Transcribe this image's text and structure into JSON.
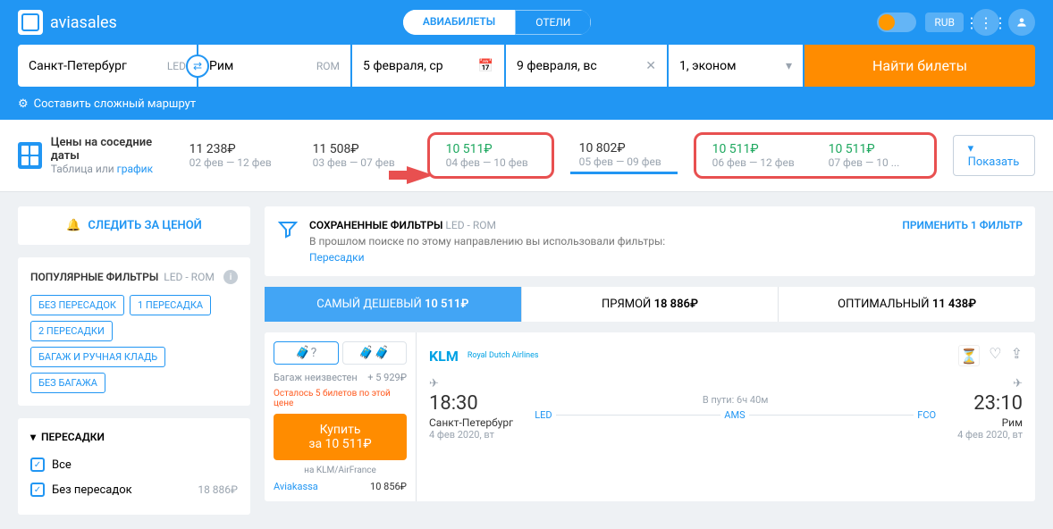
{
  "header": {
    "brand": "aviasales",
    "tabs": {
      "flights": "АВИАБИЛЕТЫ",
      "hotels": "ОТЕЛИ"
    },
    "currency": "RUB"
  },
  "search": {
    "from": {
      "city": "Санкт-Петербург",
      "code": "LED"
    },
    "to": {
      "city": "Рим",
      "code": "ROM"
    },
    "depart": "5 февраля, ср",
    "return": "9 февраля, вс",
    "pax": "1, эконом",
    "button": "Найти билеты"
  },
  "subheader": {
    "complex_route": "Составить сложный маршрут"
  },
  "datebar": {
    "title": "Цены на соседние даты",
    "sub_table": "Таблица",
    "sub_or": " или ",
    "sub_chart": "график",
    "show": "Показать",
    "cells": [
      {
        "price": "11 238₽",
        "dates": "02 фев — 12 фев",
        "green": false,
        "ring": false
      },
      {
        "price": "11 508₽",
        "dates": "03 фев — 07 фев",
        "green": false,
        "ring": false
      },
      {
        "price": "10 511₽",
        "dates": "04 фев — 10 фев",
        "green": true,
        "ring": true
      },
      {
        "price": "10 802₽",
        "dates": "05 фев — 09 фев",
        "green": false,
        "ring": false,
        "active": true
      },
      {
        "price": "10 511₽",
        "dates": "06 фев — 12 фев",
        "green": true,
        "ring": true
      },
      {
        "price": "10 511₽",
        "dates": "07 фев — 10 ...",
        "green": true,
        "ring": true
      }
    ]
  },
  "sidebar": {
    "watch": "СЛЕДИТЬ ЗА ЦЕНОЙ",
    "popular_h": "ПОПУЛЯРНЫЕ ФИЛЬТРЫ",
    "popular_sub": "LED - ROM",
    "chips": [
      "БЕЗ ПЕРЕСАДОК",
      "1 ПЕРЕСАДКА",
      "2 ПЕРЕСАДКИ",
      "БАГАЖ И РУЧНАЯ КЛАДЬ",
      "БЕЗ БАГАЖА"
    ],
    "transfers_h": "ПЕРЕСАДКИ",
    "cb_all": "Все",
    "cb_direct": "Без пересадок",
    "cb_direct_price": "18 886₽"
  },
  "saved": {
    "title": "СОХРАНЕННЫЕ ФИЛЬТРЫ",
    "sub": "LED - ROM",
    "desc": "В прошлом поиске по этому направлению вы использовали фильтры:",
    "link": "Пересадки",
    "apply": "ПРИМЕНИТЬ 1 ФИЛЬТР"
  },
  "sort": {
    "cheapest": {
      "label": "САМЫЙ ДЕШЕВЫЙ",
      "price": "10 511₽"
    },
    "direct": {
      "label": "ПРЯМОЙ",
      "price": "18 886₽"
    },
    "optimal": {
      "label": "ОПТИМАЛЬНЫЙ",
      "price": "11 438₽"
    }
  },
  "ticket": {
    "bag_unknown": "Багаж неизвестен",
    "bag_plus": "+ 5 929₽",
    "remain": "Осталось 5 билетов по этой цене",
    "buy_l1": "Купить",
    "buy_l2": "за 10 511₽",
    "via": "на KLM/AirFrance",
    "alt_name": "Aviakassa",
    "alt_price": "10 856₽",
    "airline": "KLM",
    "airline_sub": "Royal Dutch Airlines",
    "dep_time": "18:30",
    "dep_city": "Санкт-Петербург",
    "dep_date": "4 фев 2020, вт",
    "dep_code": "LED",
    "duration": "В пути: 6ч 40м",
    "stop1": "AMS",
    "arr_code": "FCO",
    "arr_time": "23:10",
    "arr_city": "Рим",
    "arr_date": "4 фев 2020, вт"
  }
}
